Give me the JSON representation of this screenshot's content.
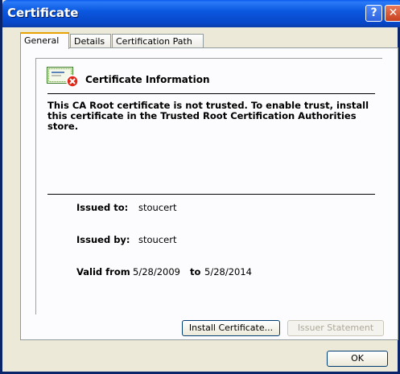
{
  "window": {
    "title": "Certificate"
  },
  "title_buttons": {
    "help": "?",
    "close": "✕"
  },
  "tabs": [
    {
      "label": "General"
    },
    {
      "label": "Details"
    },
    {
      "label": "Certification Path"
    }
  ],
  "general": {
    "info_title": "Certificate Information",
    "warning": "This CA Root certificate is not trusted. To enable trust, install this certificate in the Trusted Root Certification Authorities store.",
    "issued_to_label": "Issued to:",
    "issued_to_value": "stoucert",
    "issued_by_label": "Issued by:",
    "issued_by_value": "stoucert",
    "valid_from_label": "Valid from",
    "valid_from_value": "5/28/2009",
    "to_label": "to",
    "valid_to_value": "5/28/2014"
  },
  "buttons": {
    "install": "Install Certificate...",
    "issuer_statement": "Issuer Statement",
    "ok": "OK"
  }
}
